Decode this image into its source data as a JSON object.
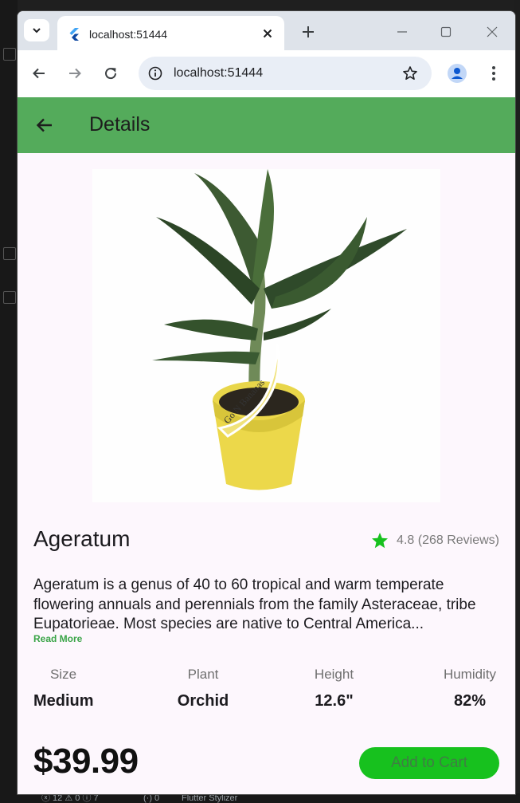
{
  "browser": {
    "tab_title": "localhost:51444",
    "url": "localhost:51444",
    "icons": {
      "tab_menu": "chevron-down-icon",
      "favicon": "flutter-logo",
      "tab_close": "close-icon",
      "new_tab": "plus-icon",
      "minimize": "minimize-icon",
      "maximize": "maximize-icon",
      "close": "close-icon",
      "back": "arrow-left-icon",
      "forward": "arrow-right-icon",
      "reload": "reload-icon",
      "site_info": "info-icon",
      "bookmark": "star-outline-icon",
      "profile": "person-icon",
      "menu": "kebab-menu-icon"
    }
  },
  "appbar": {
    "title": "Details",
    "back_icon": "arrow-left-icon",
    "color": "#54ab5b"
  },
  "product": {
    "image_alt": "Banana plant in a yellow pot",
    "pot_label": "Go N Bananas",
    "name": "Ageratum",
    "rating": "4.8 (268 Reviews)",
    "rating_star_color": "#17c11e",
    "description": "Ageratum is a genus of 40 to 60 tropical and warm temperate flowering annuals and perennials from the family Asteraceae, tribe Eupatorieae. Most species are native to Central America...",
    "read_more": "Read More",
    "specs": [
      {
        "label": "Size",
        "value": "Medium"
      },
      {
        "label": "Plant",
        "value": "Orchid"
      },
      {
        "label": "Height",
        "value": "12.6\""
      },
      {
        "label": "Humidity",
        "value": "82%"
      }
    ],
    "price": "$39.99",
    "add_to_cart": "Add to Cart",
    "button_color": "#17c11e"
  },
  "ide_status": {
    "problems": "ⓧ 12 ⚠ 0 ⓘ 7",
    "ports": "(·) 0",
    "extension": "Flutter Stylizer"
  }
}
